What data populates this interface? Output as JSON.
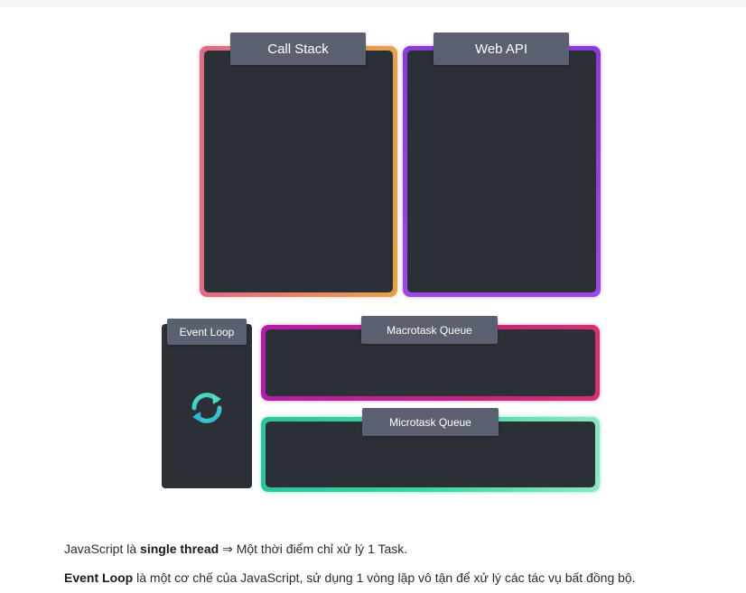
{
  "diagram": {
    "call_stack_label": "Call Stack",
    "web_api_label": "Web API",
    "event_loop_label": "Event Loop",
    "macrotask_label": "Macrotask Queue",
    "microtask_label": "Microtask Queue",
    "event_loop_icon": "sync-icon"
  },
  "colors": {
    "call_stack_border": "#e38a6a",
    "web_api_border": "#9a4ae0",
    "macrotask_border": "#c42480",
    "microtask_border": "#3ad7a4",
    "panel_fill": "#2b2f36",
    "label_fill": "#5a6070"
  },
  "text": {
    "p1_prefix": "JavaScript là ",
    "p1_bold": "single thread",
    "p1_suffix": " ⇒ Một thời điểm chỉ xử lý 1 Task.",
    "p2_bold": "Event Loop",
    "p2_suffix": " là một cơ chế của JavaScript, sử dụng 1 vòng lặp vô tận để xử lý các tác vụ bất đồng bộ."
  }
}
